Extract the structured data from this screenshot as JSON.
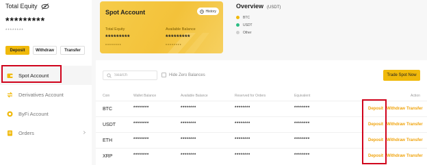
{
  "equity": {
    "title": "Total Equity",
    "value": "*********",
    "sub": "********"
  },
  "actions": {
    "deposit": "Deposit",
    "withdraw": "Withdraw",
    "transfer": "Transfer"
  },
  "nav": {
    "items": [
      {
        "label": "Spot Account",
        "icon": "wallet-icon"
      },
      {
        "label": "Derivatives Account",
        "icon": "swap-icon"
      },
      {
        "label": "ByFi Account",
        "icon": "coin-icon"
      },
      {
        "label": "Orders",
        "icon": "orders-icon"
      }
    ]
  },
  "card": {
    "title": "Spot Account",
    "history": "History",
    "equity_label": "Total Equity",
    "equity_value": "*********",
    "equity_sub": "********",
    "available_label": "Available Balance",
    "available_value": "*********",
    "available_sub": "********"
  },
  "overview": {
    "title": "Overview",
    "unit": "(USDT)",
    "legend": [
      {
        "label": "BTC",
        "color": "#f0b90b"
      },
      {
        "label": "USDT",
        "color": "#2dbd85"
      },
      {
        "label": "Other",
        "color": "#cfcfcf"
      }
    ]
  },
  "toolbar": {
    "search_placeholder": "Search",
    "hide_zero": "Hide Zero Balances",
    "trade": "Trade Spot Now"
  },
  "table": {
    "headers": {
      "coin": "Coin",
      "wallet": "Wallet Balance",
      "available": "Available Balance",
      "reserved": "Reserved for Orders",
      "equivalent": "Equivalent",
      "action": "Action"
    },
    "rows": [
      {
        "coin": "BTC",
        "wallet": "********",
        "available": "********",
        "reserved": "********",
        "equivalent": "********",
        "deposit": "Deposit",
        "withdraw": "Withdraw",
        "transfer": "Transfer"
      },
      {
        "coin": "USDT",
        "wallet": "********",
        "available": "********",
        "reserved": "********",
        "equivalent": "********",
        "deposit": "Deposit",
        "withdraw": "Withdraw",
        "transfer": "Transfer"
      },
      {
        "coin": "ETH",
        "wallet": "********",
        "available": "********",
        "reserved": "********",
        "equivalent": "********",
        "deposit": "Deposit",
        "withdraw": "Withdraw",
        "transfer": "Transfer"
      },
      {
        "coin": "XRP",
        "wallet": "********",
        "available": "********",
        "reserved": "********",
        "equivalent": "********",
        "deposit": "Deposit",
        "withdraw": "Withdraw",
        "transfer": "Transfer"
      }
    ]
  },
  "colors": {
    "accent": "#f0b90b",
    "highlight": "#d0021b"
  }
}
